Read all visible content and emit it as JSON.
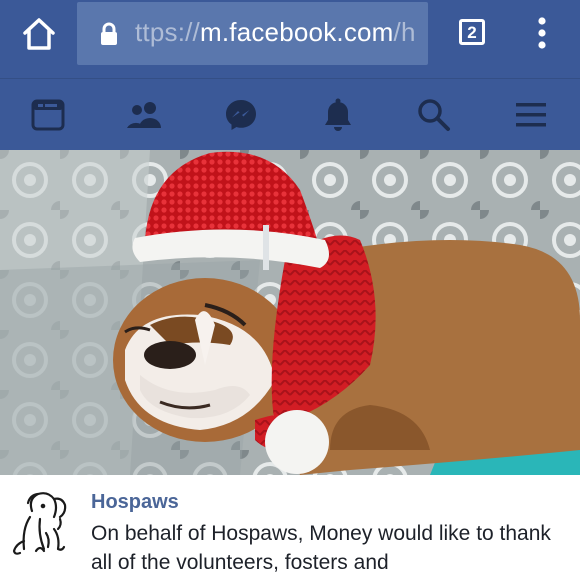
{
  "browser": {
    "url_prefix": "ttps://",
    "url_host": "m.facebook.com",
    "url_suffix": "/h",
    "tab_count": "2",
    "icons": {
      "home": "home-icon",
      "lock": "lock-icon",
      "menu": "more-vert-icon"
    }
  },
  "fb_nav": {
    "items": [
      {
        "name": "news-feed",
        "icon": "news-feed-icon"
      },
      {
        "name": "friends",
        "icon": "friends-icon"
      },
      {
        "name": "messenger",
        "icon": "messenger-icon"
      },
      {
        "name": "notifications",
        "icon": "bell-icon"
      },
      {
        "name": "search",
        "icon": "search-icon"
      },
      {
        "name": "menu",
        "icon": "hamburger-icon"
      }
    ]
  },
  "post": {
    "author": "Hospaws",
    "text": "On behalf of Hospaws, Money would like to thank all of the volunteers, fosters and"
  },
  "colors": {
    "facebook_blue": "#3b5998",
    "url_bar": "#5a77ad",
    "author_link": "#4b6698"
  }
}
